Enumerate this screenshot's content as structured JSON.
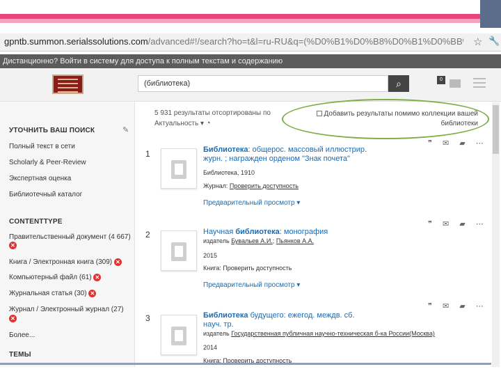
{
  "browser": {
    "url_main": "gpntb.summon.serialssolutions.com",
    "url_rest": "/advanced#!/search?ho=t&l=ru-RU&q=(%D0%B1%D0%B8%D0%B1%D0%BB%D0%"
  },
  "notice": "Дистанционно? Войти в систему для доступа к полным текстам и содержанию",
  "search": {
    "value": "(библиотека)"
  },
  "header": {
    "badge": "0"
  },
  "sidebar": {
    "refine_heading": "УТОЧНИТЬ ВАШ ПОИСК",
    "filters": [
      "Полный текст в сети",
      "Scholarly & Peer-Review",
      "Экспертная оценка",
      "Библиотечный каталог"
    ],
    "contenttype_heading": "CONTENTTYPE",
    "contenttypes": [
      {
        "label": "Правительственный документ (4 667)"
      },
      {
        "label": "Книга / Электронная книга (309)"
      },
      {
        "label": "Компьютерный файл (61)"
      },
      {
        "label": "Журнальная статья (30)"
      },
      {
        "label": "Журнал / Электронный журнал (27)"
      }
    ],
    "more": "Более...",
    "topics_heading": "ТЕМЫ"
  },
  "main": {
    "count": "5 931 результаты отсортированы по",
    "sort": "Актуальность ▾",
    "add_collection": [
      "Добавить результаты помимо коллекции вашей",
      "библиотеки"
    ]
  },
  "results": [
    {
      "num": "1",
      "title_bold": "Библиотека",
      "title_rest": ": общерос. массовый иллюстрир. журн. ; награжден орденом \"Знак почета\"",
      "line1": "Библиотека, 1910",
      "line2_prefix": "Журнал: ",
      "line2_link": "Проверить доступность",
      "preview": "Предварительный просмотр ▾"
    },
    {
      "num": "2",
      "title_pre": "Научная ",
      "title_bold": "библиотека",
      "title_rest": ": монография",
      "authors_prefix": "издатель ",
      "author1": "Бувальев А.И.",
      "author2": "Пьянков А.А.",
      "line1": "2015",
      "line2": "Книга: Проверить доступность",
      "preview": "Предварительный просмотр ▾"
    },
    {
      "num": "3",
      "title_bold": "Библиотека",
      "title_rest": " будущего: ежегод. междв. сб. науч. тр.",
      "publisher_prefix": "издатель ",
      "publisher_link": "Государственная публичная научно-техническая б-ка России(Москва)",
      "line1": "2014",
      "line2": "Книга: Проверить доступность"
    }
  ],
  "icons": {
    "actions": "❞ ✉ ▰ ⋯"
  }
}
